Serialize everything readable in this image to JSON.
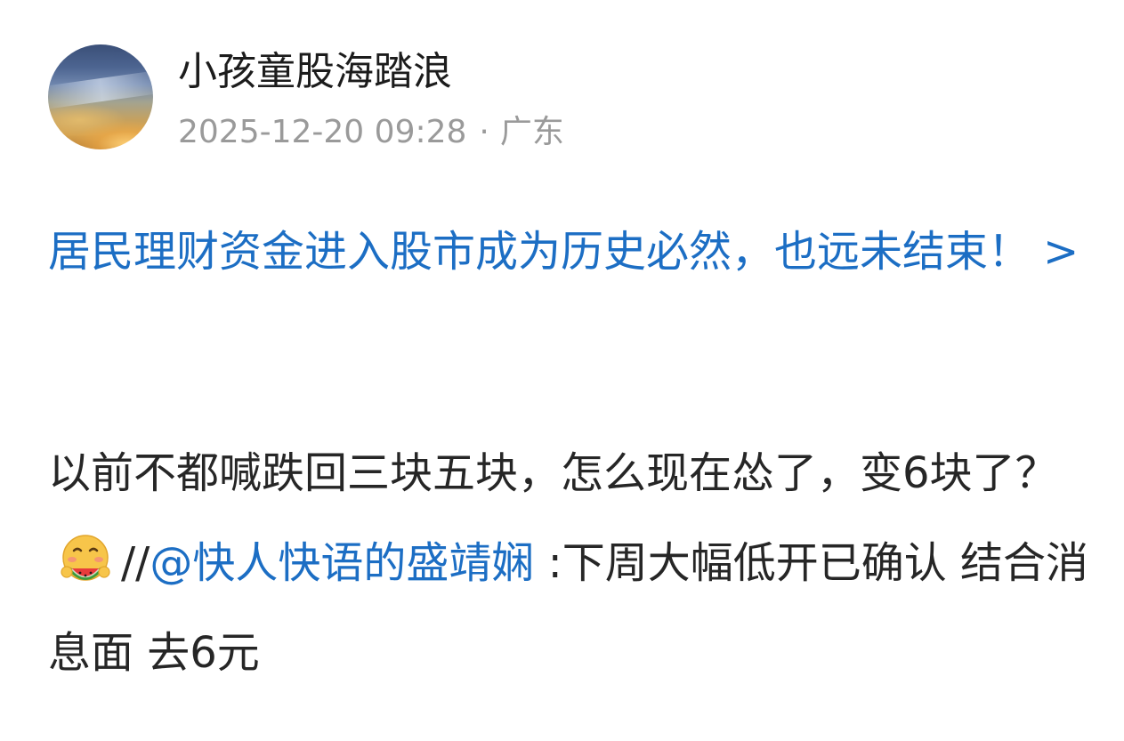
{
  "post": {
    "author": {
      "name": "小孩童股海踏浪",
      "avatar_icon": "beach-sunset-avatar"
    },
    "timestamp": "2025-12-20 09:28",
    "separator": "·",
    "location": "广东",
    "headline": {
      "text": "居民理财资金进入股市成为历史必然，也远未结束！",
      "arrow": ">"
    },
    "body": {
      "part1": "以前不都喊跌回三块五块，怎么现在怂了，变6块了？",
      "emoji_icon": "watermelon-eating-emoji",
      "slashes": "//",
      "mention": "@快人快语的盛靖娴",
      "part2": " :下周大幅低开已确认 结合消息面 去6元"
    }
  },
  "colors": {
    "link_blue": "#1c6ec4",
    "meta_gray": "#9a9a9a",
    "text": "#262626"
  }
}
